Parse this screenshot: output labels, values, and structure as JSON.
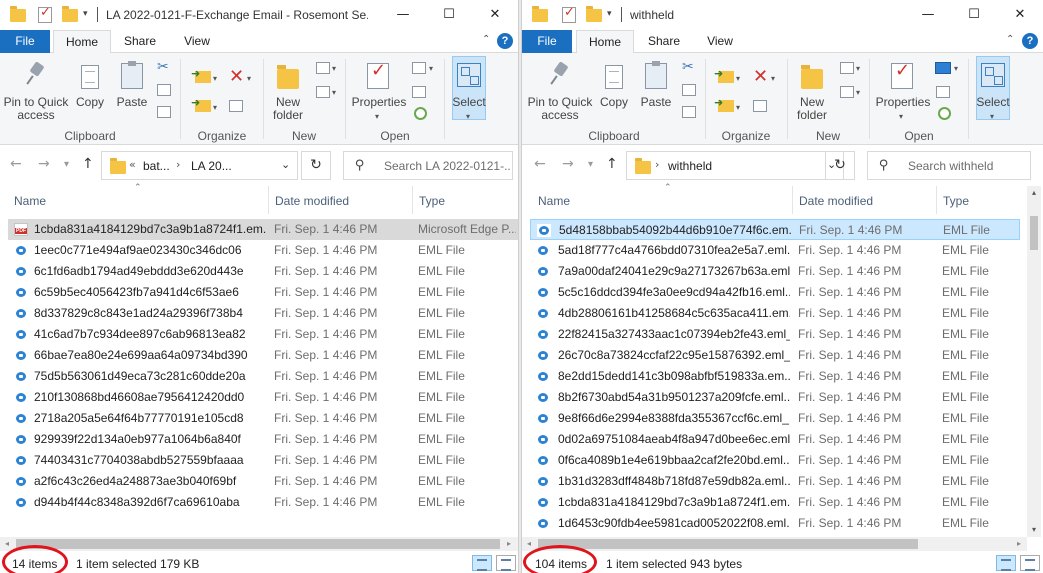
{
  "left": {
    "title": "LA 2022-0121-F-Exchange Email - Rosemont Se...",
    "tabs": {
      "file": "File",
      "home": "Home",
      "share": "Share",
      "view": "View"
    },
    "ribbon": {
      "pin": "Pin to Quick access",
      "copy": "Copy",
      "paste": "Paste",
      "new_folder": "New folder",
      "properties": "Properties",
      "select": "Select",
      "groups": {
        "clipboard": "Clipboard",
        "organize": "Organize",
        "new": "New",
        "open": "Open"
      }
    },
    "address": {
      "overflow": "«",
      "crumb1": "bat...",
      "crumb2": "LA 20..."
    },
    "search_placeholder": "Search LA 2022-0121-...",
    "columns": {
      "name": "Name",
      "date": "Date modified",
      "type": "Type"
    },
    "rows": [
      {
        "name": "1cbda831a4184129bd7c3a9b1a8724f1.em...",
        "date": "Fri. Sep. 1 4:46 PM",
        "type": "Microsoft Edge P...",
        "icon": "pdf"
      },
      {
        "name": "1eec0c771e494af9ae023430c346dc06",
        "date": "Fri. Sep. 1 4:46 PM",
        "type": "EML File",
        "icon": "eml"
      },
      {
        "name": "6c1fd6adb1794ad49ebddd3e620d443e",
        "date": "Fri. Sep. 1 4:46 PM",
        "type": "EML File",
        "icon": "eml"
      },
      {
        "name": "6c59b5ec4056423fb7a941d4c6f53ae6",
        "date": "Fri. Sep. 1 4:46 PM",
        "type": "EML File",
        "icon": "eml"
      },
      {
        "name": "8d337829c8c843e1ad24a29396f738b4",
        "date": "Fri. Sep. 1 4:46 PM",
        "type": "EML File",
        "icon": "eml"
      },
      {
        "name": "41c6ad7b7c934dee897c6ab96813ea82",
        "date": "Fri. Sep. 1 4:46 PM",
        "type": "EML File",
        "icon": "eml"
      },
      {
        "name": "66bae7ea80e24e699aa64a09734bd390",
        "date": "Fri. Sep. 1 4:46 PM",
        "type": "EML File",
        "icon": "eml"
      },
      {
        "name": "75d5b563061d49eca73c281c60dde20a",
        "date": "Fri. Sep. 1 4:46 PM",
        "type": "EML File",
        "icon": "eml"
      },
      {
        "name": "210f130868bd46608ae7956412420dd0",
        "date": "Fri. Sep. 1 4:46 PM",
        "type": "EML File",
        "icon": "eml"
      },
      {
        "name": "2718a205a5e64f64b77770191e105cd8",
        "date": "Fri. Sep. 1 4:46 PM",
        "type": "EML File",
        "icon": "eml"
      },
      {
        "name": "929939f22d134a0eb977a1064b6a840f",
        "date": "Fri. Sep. 1 4:46 PM",
        "type": "EML File",
        "icon": "eml"
      },
      {
        "name": "74403431c7704038abdb527559bfaaaa",
        "date": "Fri. Sep. 1 4:46 PM",
        "type": "EML File",
        "icon": "eml"
      },
      {
        "name": "a2f6c43c26ed4a248873ae3b040f69bf",
        "date": "Fri. Sep. 1 4:46 PM",
        "type": "EML File",
        "icon": "eml"
      },
      {
        "name": "d944b4f44c8348a392d6f7ca69610aba",
        "date": "Fri. Sep. 1 4:46 PM",
        "type": "EML File",
        "icon": "eml"
      }
    ],
    "status": {
      "count": "14 items",
      "selected": "1 item selected  179 KB"
    }
  },
  "right": {
    "title": "withheld",
    "tabs": {
      "file": "File",
      "home": "Home",
      "share": "Share",
      "view": "View"
    },
    "ribbon": {
      "pin": "Pin to Quick access",
      "copy": "Copy",
      "paste": "Paste",
      "new_folder": "New folder",
      "properties": "Properties",
      "select": "Select",
      "groups": {
        "clipboard": "Clipboard",
        "organize": "Organize",
        "new": "New",
        "open": "Open"
      }
    },
    "address": {
      "crumb1": "withheld"
    },
    "search_placeholder": "Search withheld",
    "columns": {
      "name": "Name",
      "date": "Date modified",
      "type": "Type"
    },
    "rows": [
      {
        "name": "5d48158bbab54092b44d6b910e774f6c.em...",
        "date": "Fri. Sep. 1 4:46 PM",
        "type": "EML File"
      },
      {
        "name": "5ad18f777c4a4766bdd07310fea2e5a7.eml...",
        "date": "Fri. Sep. 1 4:46 PM",
        "type": "EML File"
      },
      {
        "name": "7a9a00daf24041e29c9a27173267b63a.eml...",
        "date": "Fri. Sep. 1 4:46 PM",
        "type": "EML File"
      },
      {
        "name": "5c5c16ddcd394fe3a0ee9cd94a42fb16.eml...",
        "date": "Fri. Sep. 1 4:46 PM",
        "type": "EML File"
      },
      {
        "name": "4db28806161b41258684c5c635aca411.em...",
        "date": "Fri. Sep. 1 4:46 PM",
        "type": "EML File"
      },
      {
        "name": "22f82415a327433aac1c07394eb2fe43.eml_...",
        "date": "Fri. Sep. 1 4:46 PM",
        "type": "EML File"
      },
      {
        "name": "26c70c8a73824ccfaf22c95e15876392.eml_...",
        "date": "Fri. Sep. 1 4:46 PM",
        "type": "EML File"
      },
      {
        "name": "8e2dd15dedd141c3b098abfbf519833a.em...",
        "date": "Fri. Sep. 1 4:46 PM",
        "type": "EML File"
      },
      {
        "name": "8b2f6730abd54a31b9501237a209fcfe.eml...",
        "date": "Fri. Sep. 1 4:46 PM",
        "type": "EML File"
      },
      {
        "name": "9e8f66d6e2994e8388fda355367ccf6c.eml_...",
        "date": "Fri. Sep. 1 4:46 PM",
        "type": "EML File"
      },
      {
        "name": "0d02a69751084aeab4f8a947d0bee6ec.eml...",
        "date": "Fri. Sep. 1 4:46 PM",
        "type": "EML File"
      },
      {
        "name": "0f6ca4089b1e4e619bbaa2caf2fe20bd.eml...",
        "date": "Fri. Sep. 1 4:46 PM",
        "type": "EML File"
      },
      {
        "name": "1b31d3283dff4848b718fd87e59db82a.eml...",
        "date": "Fri. Sep. 1 4:46 PM",
        "type": "EML File"
      },
      {
        "name": "1cbda831a4184129bd7c3a9b1a8724f1.em...",
        "date": "Fri. Sep. 1 4:46 PM",
        "type": "EML File"
      },
      {
        "name": "1d6453c90fdb4ee5981cad0052022f08.eml...",
        "date": "Fri. Sep. 1 4:46 PM",
        "type": "EML File"
      }
    ],
    "status": {
      "count": "104 items",
      "selected": "1 item selected  943 bytes"
    }
  },
  "colors": {
    "accent": "#1a6fc0",
    "selection": "#cce8ff",
    "annotation": "#e0141c"
  }
}
